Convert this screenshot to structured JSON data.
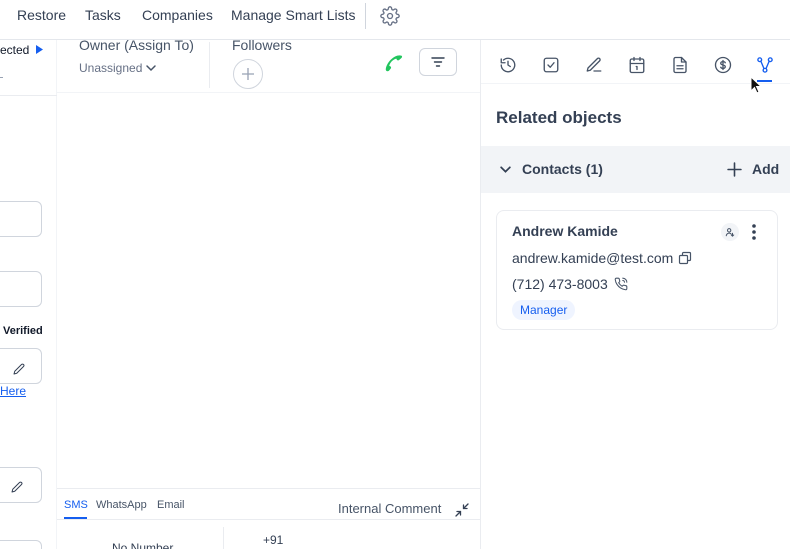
{
  "topnav": {
    "items": [
      "Restore",
      "Tasks",
      "Companies",
      "Manage Smart Lists"
    ]
  },
  "left_strip": {
    "connected_fragment": "ected",
    "verified_label": "Verified",
    "here_link": "Here"
  },
  "middle": {
    "owner_label": "Owner (Assign To)",
    "owner_value": "Unassigned",
    "followers_label": "Followers",
    "composer": {
      "tabs": [
        "SMS",
        "WhatsApp",
        "Email"
      ],
      "active_tab": "SMS",
      "internal_comment": "Internal Comment",
      "from_value": "No Number",
      "to_value": "+91"
    }
  },
  "right_panel": {
    "tabs": [
      "activity-icon",
      "tasks-icon",
      "notes-icon",
      "calendar-icon",
      "documents-icon",
      "payments-icon",
      "related-objects-icon"
    ],
    "active_tab": "related-objects-icon",
    "title": "Related objects",
    "section_label": "Contacts (1)",
    "add_label": "Add",
    "contact": {
      "name": "Andrew Kamide",
      "email": "andrew.kamide@test.com",
      "phone": "(712) 473-8003",
      "badge": "Manager"
    }
  },
  "colors": {
    "accent": "#155eef",
    "phone_green": "#22c55e",
    "text": "#344054",
    "border": "#d0d5dd"
  }
}
